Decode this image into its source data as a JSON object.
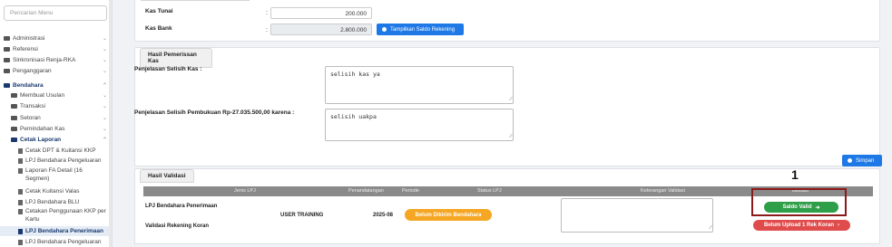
{
  "sidebar": {
    "search_placeholder": "Pencarian Menu",
    "items": [
      {
        "label": "Administrasi"
      },
      {
        "label": "Referensi"
      },
      {
        "label": "Sinkronisasi Renja-RKA"
      },
      {
        "label": "Penganggaran"
      },
      {
        "label": "Bendahara"
      },
      {
        "label": "Membuat Usulan"
      },
      {
        "label": "Transaksi"
      },
      {
        "label": "Setoran"
      },
      {
        "label": "Pemindahan Kas"
      },
      {
        "label": "Cetak Laporan"
      },
      {
        "label": "Cetak DPT & Kuitansi KKP"
      },
      {
        "label": "LPJ Bendahara Pengeluaran"
      },
      {
        "label": "Laporan FA Detail (16 Segmen)"
      },
      {
        "label": "Cetak Kuitansi Valas"
      },
      {
        "label": "LPJ Bendahara BLU"
      },
      {
        "label": "Cetakan Penggunaan KKP per Kartu"
      },
      {
        "label": "LPJ Bendahara Penerimaan"
      },
      {
        "label": "LPJ Bendahara Pengeluaran"
      }
    ]
  },
  "kas": {
    "tunai_label": "Kas Tunai",
    "tunai_value": "200.000",
    "bank_label": "Kas Bank",
    "bank_value": "2.800.000",
    "show_saldo_button": "Tampilkan Saldo Rekening",
    "colon": ":"
  },
  "pemeriksaan": {
    "title": "Hasil Pemerissan Kas",
    "selisih_kas_label": "Penjelasan Selisih Kas :",
    "selisih_kas_value": "selisih kas ya",
    "selisih_pembukuan_label": "Penjelasan Selisih Pembukuan Rp-27.035.500,00 karena :",
    "selisih_pembukuan_value": "selisih uakpa",
    "simpan_button": "Simpan"
  },
  "validasi": {
    "title": "Hasil Validasi",
    "columns": [
      "Jenis LPJ",
      "Penandatangan",
      "Periode",
      "Status LPJ",
      "Keterangan Validasi",
      "Validasi"
    ],
    "rows": [
      {
        "jenis": "LPJ Bendahara Penerimaan"
      },
      {
        "jenis": "Validasi Rekening Koran"
      }
    ],
    "penandatangan": "USER TRAINING",
    "periode": "2025-08",
    "status": "Belum Dikirim Bendahara",
    "saldo_valid_button": "Saldo Valid",
    "upload_button": "Belum Upload 1 Rek Koran"
  },
  "annotation": {
    "number": "1"
  },
  "colors": {
    "primary": "#1e78e6",
    "success": "#2e9e48",
    "danger": "#e04b4b",
    "warning": "#f5a623",
    "annotation": "#8b1a1a"
  }
}
